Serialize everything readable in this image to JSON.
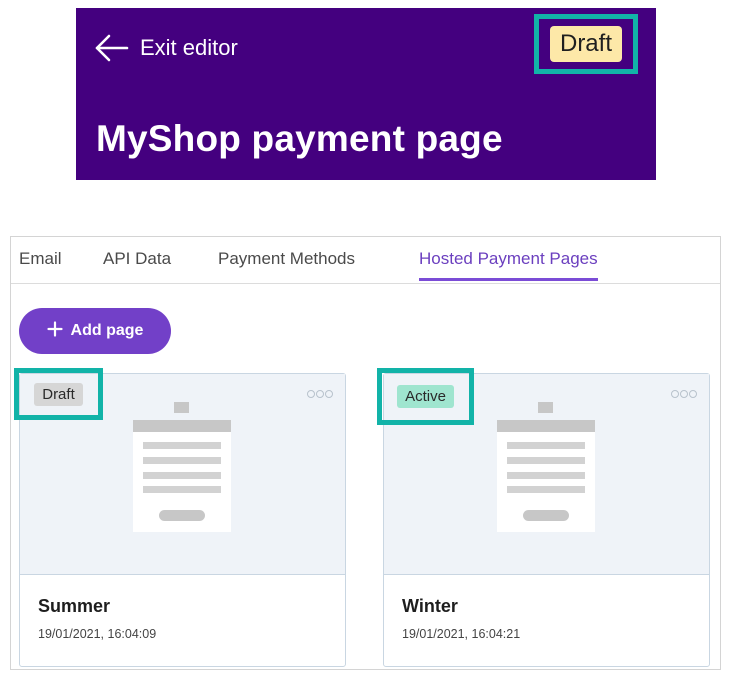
{
  "editor": {
    "exit_label": "Exit editor",
    "status_badge": "Draft",
    "title": "MyShop payment page"
  },
  "tabs": [
    {
      "label": "Email"
    },
    {
      "label": "API Data"
    },
    {
      "label": "Payment Methods"
    },
    {
      "label": "Hosted Payment Pages",
      "active": true
    }
  ],
  "add_button": {
    "label": "Add page",
    "icon": "plus-icon"
  },
  "cards": [
    {
      "status": "Draft",
      "name": "Summer",
      "date": "19/01/2021, 16:04:09"
    },
    {
      "status": "Active",
      "name": "Winter",
      "date": "19/01/2021, 16:04:21"
    }
  ],
  "colors": {
    "header_bg": "#44007f",
    "highlight": "#12b3a8",
    "draft_top_badge": "#fde8a8",
    "draft_card_badge": "#d6d6d6",
    "active_badge": "#9fe5cf",
    "accent": "#7240c8",
    "card_preview_bg": "#eff3f8"
  },
  "icons": {
    "exit": "arrow-left-icon",
    "card_menu": "more-dots-icon"
  }
}
